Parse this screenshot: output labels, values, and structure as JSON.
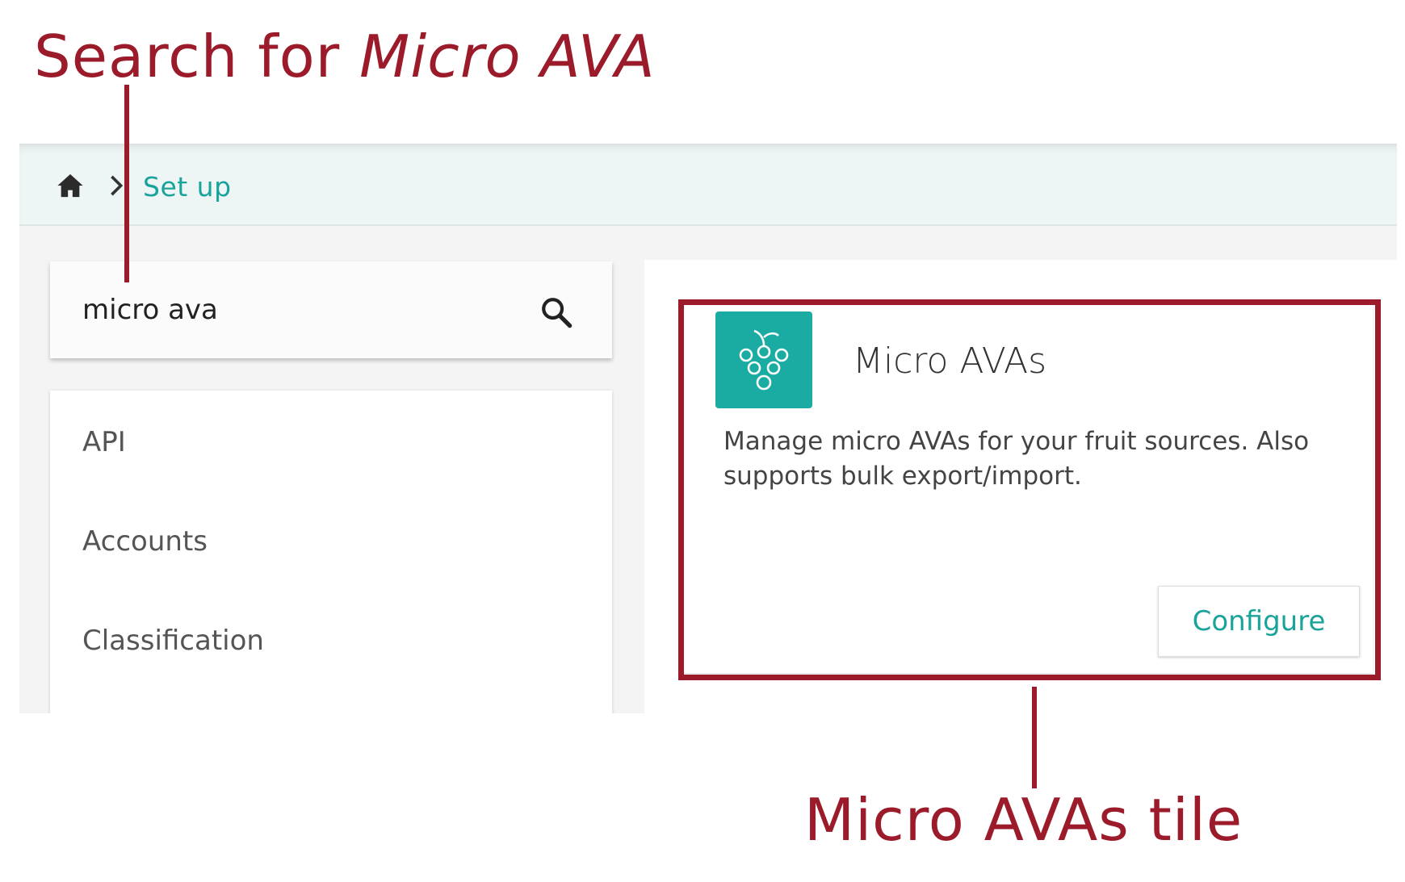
{
  "annotations": {
    "top_prefix": "Search for ",
    "top_italic": "Micro AVA",
    "bottom": "Micro AVAs tile",
    "color": "#9b1b2a"
  },
  "breadcrumb": {
    "home_icon": "home-icon",
    "separator_icon": "chevron-right-icon",
    "current": "Set up"
  },
  "search": {
    "value": "micro ava",
    "icon": "search-icon"
  },
  "sidebar": {
    "items": [
      {
        "label": "API"
      },
      {
        "label": "Accounts"
      },
      {
        "label": "Classification"
      }
    ]
  },
  "tile": {
    "icon": "grapes-icon",
    "title": "Micro AVAs",
    "description": "Manage micro AVAs for your fruit sources. Also supports bulk export/import.",
    "button_label": "Configure"
  },
  "colors": {
    "accent": "#1aa39a",
    "tile_icon_bg": "#1aaba3"
  }
}
